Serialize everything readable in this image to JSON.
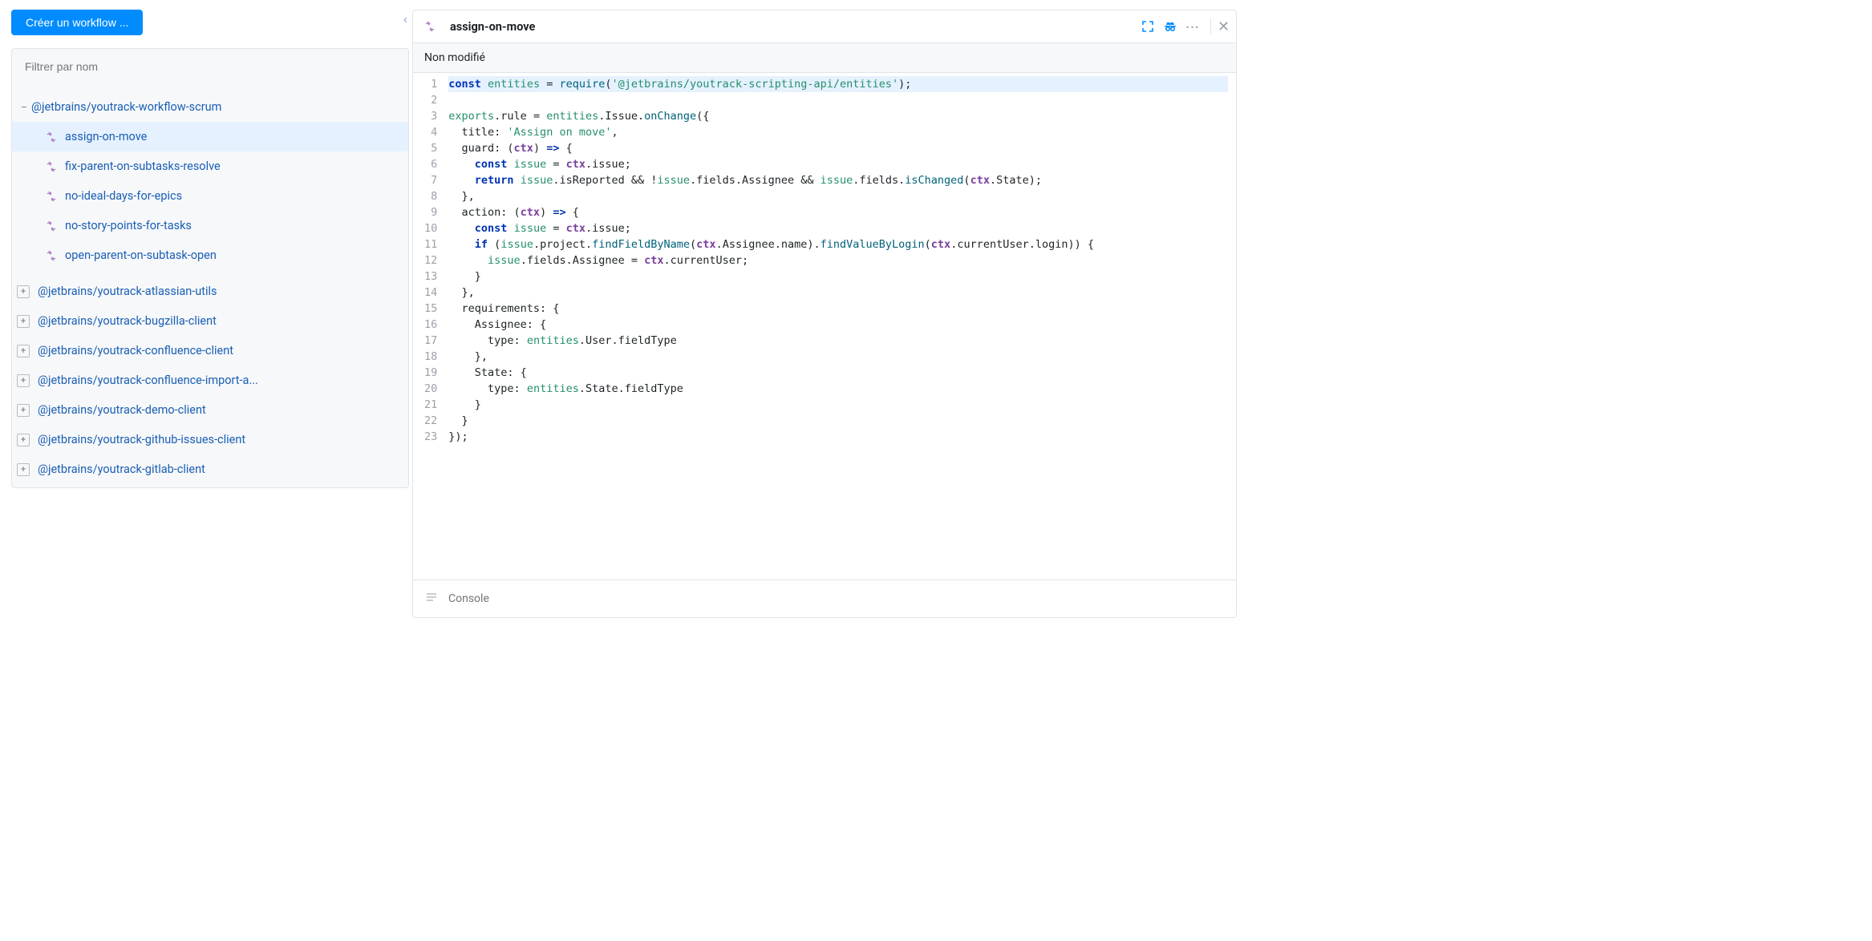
{
  "left": {
    "create_button": "Créer un workflow ...",
    "filter_placeholder": "Filtrer par nom",
    "expanded_group": "@jetbrains/youtrack-workflow-scrum",
    "rules": [
      "assign-on-move",
      "fix-parent-on-subtasks-resolve",
      "no-ideal-days-for-epics",
      "no-story-points-for-tasks",
      "open-parent-on-subtask-open"
    ],
    "selected_rule": "assign-on-move",
    "collapsed_groups": [
      "@jetbrains/youtrack-atlassian-utils",
      "@jetbrains/youtrack-bugzilla-client",
      "@jetbrains/youtrack-confluence-client",
      "@jetbrains/youtrack-confluence-import-a...",
      "@jetbrains/youtrack-demo-client",
      "@jetbrains/youtrack-github-issues-client",
      "@jetbrains/youtrack-gitlab-client"
    ]
  },
  "editor": {
    "title": "assign-on-move",
    "status": "Non modifié",
    "console_label": "Console",
    "code_lines": [
      {
        "n": 1,
        "hl": true,
        "html": "<span class='kw'>const</span> <span class='ent'>entities</span> = <span class='fn'>require</span>(<span class='str'>'@jetbrains/youtrack-scripting-api/entities'</span>);"
      },
      {
        "n": 2,
        "html": ""
      },
      {
        "n": 3,
        "html": "<span class='ent'>exports</span>.rule = <span class='ent'>entities</span>.Issue.<span class='fn'>onChange</span>({"
      },
      {
        "n": 4,
        "html": "  title: <span class='str'>'Assign on move'</span>,"
      },
      {
        "n": 5,
        "html": "  guard: (<span class='par'>ctx</span>) <span class='kw'>=&gt;</span> {"
      },
      {
        "n": 6,
        "html": "    <span class='kw'>const</span> <span class='ent'>issue</span> = <span class='par'>ctx</span>.issue;"
      },
      {
        "n": 7,
        "html": "    <span class='kw'>return</span> <span class='ent'>issue</span>.isReported &amp;&amp; !<span class='ent'>issue</span>.fields.Assignee &amp;&amp; <span class='ent'>issue</span>.fields.<span class='fn'>isChanged</span>(<span class='par'>ctx</span>.State);"
      },
      {
        "n": 8,
        "html": "  },"
      },
      {
        "n": 9,
        "html": "  action: (<span class='par'>ctx</span>) <span class='kw'>=&gt;</span> {"
      },
      {
        "n": 10,
        "html": "    <span class='kw'>const</span> <span class='ent'>issue</span> = <span class='par'>ctx</span>.issue;"
      },
      {
        "n": 11,
        "html": "    <span class='kw'>if</span> (<span class='ent'>issue</span>.project.<span class='fn'>findFieldByName</span>(<span class='par'>ctx</span>.Assignee.name).<span class='fn'>findValueByLogin</span>(<span class='par'>ctx</span>.currentUser.login)) {"
      },
      {
        "n": 12,
        "html": "      <span class='ent'>issue</span>.fields.Assignee = <span class='par'>ctx</span>.currentUser;"
      },
      {
        "n": 13,
        "html": "    }"
      },
      {
        "n": 14,
        "html": "  },"
      },
      {
        "n": 15,
        "html": "  requirements: {"
      },
      {
        "n": 16,
        "html": "    Assignee: {"
      },
      {
        "n": 17,
        "html": "      type: <span class='ent'>entities</span>.User.fieldType"
      },
      {
        "n": 18,
        "html": "    },"
      },
      {
        "n": 19,
        "html": "    State: {"
      },
      {
        "n": 20,
        "html": "      type: <span class='ent'>entities</span>.State.fieldType"
      },
      {
        "n": 21,
        "html": "    }"
      },
      {
        "n": 22,
        "html": "  }"
      },
      {
        "n": 23,
        "html": "});"
      }
    ]
  }
}
